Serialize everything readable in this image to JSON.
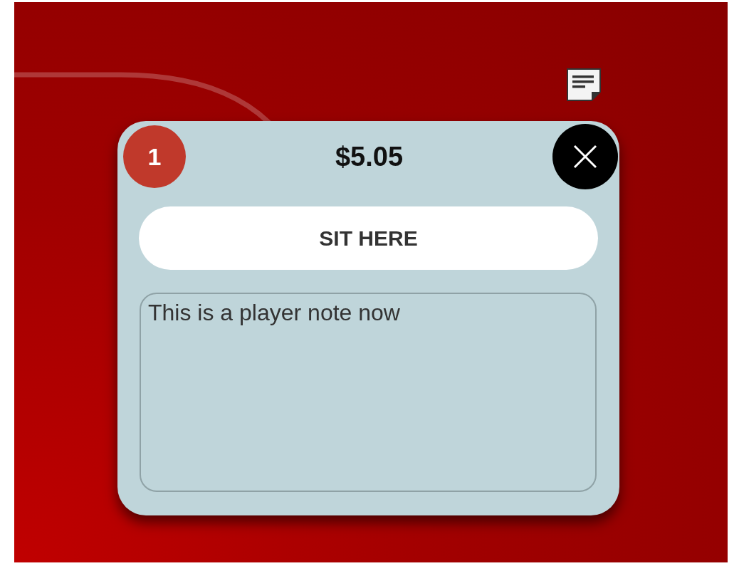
{
  "seat_popup": {
    "seat_number": "1",
    "amount": "$5.05",
    "sit_button": "SIT HERE",
    "note": {
      "value": "This is a player note now"
    }
  }
}
